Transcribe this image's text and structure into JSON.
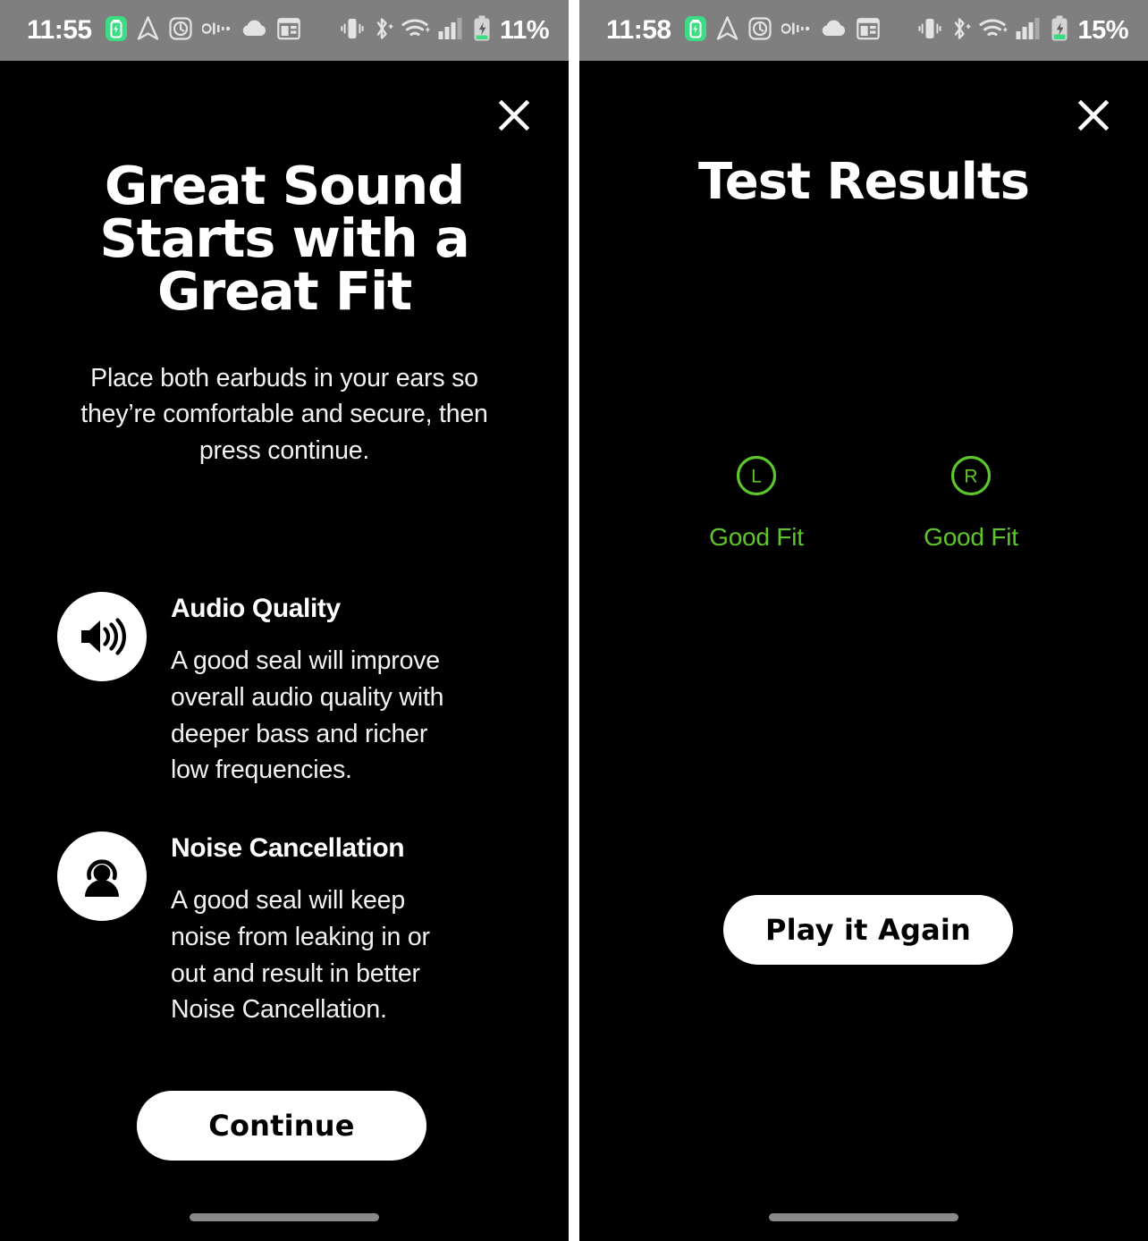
{
  "theme": {
    "background": "#000000",
    "statusbar_bg": "#7f7f7f",
    "text_primary": "#ffffff",
    "accent_green": "#5ec62a",
    "battery_green": "#3ddc84",
    "button_bg": "#ffffff",
    "button_text": "#000000",
    "nav_pill": "#8a8a8a"
  },
  "left_screen": {
    "status_bar": {
      "clock": "11:55",
      "battery_percent": "11%",
      "left_icons": [
        "battery-saver-icon",
        "navigation-arrow-icon",
        "alarm-clock-icon",
        "volume-meter-icon",
        "cloud-icon",
        "calendar-widget-icon"
      ],
      "right_icons": [
        "vibrate-icon",
        "bluetooth-icon",
        "wifi-icon",
        "cell-signal-icon",
        "charging-battery-icon"
      ]
    },
    "close_label": "✕",
    "title": "Great Sound Starts with a Great Fit",
    "subtitle": "Place both earbuds in your ears so they’re comfortable and secure, then press continue.",
    "features": [
      {
        "icon": "speaker-volume-icon",
        "title": "Audio Quality",
        "body": "A good seal will improve overall audio quality with deeper bass and richer low frequencies."
      },
      {
        "icon": "person-noise-cancellation-icon",
        "title": "Noise Cancellation",
        "body": "A good seal will keep noise from leaking in or out and result in better Noise Cancellation."
      }
    ],
    "primary_button": "Continue"
  },
  "right_screen": {
    "status_bar": {
      "clock": "11:58",
      "battery_percent": "15%",
      "left_icons": [
        "battery-saver-icon",
        "navigation-arrow-icon",
        "alarm-clock-icon",
        "volume-meter-icon",
        "cloud-icon",
        "calendar-widget-icon"
      ],
      "right_icons": [
        "vibrate-icon",
        "bluetooth-icon",
        "wifi-icon",
        "cell-signal-icon",
        "charging-battery-icon"
      ]
    },
    "close_label": "✕",
    "title": "Test Results",
    "results": [
      {
        "side": "L",
        "status": "Good Fit"
      },
      {
        "side": "R",
        "status": "Good Fit"
      }
    ],
    "primary_button": "Play it Again"
  }
}
